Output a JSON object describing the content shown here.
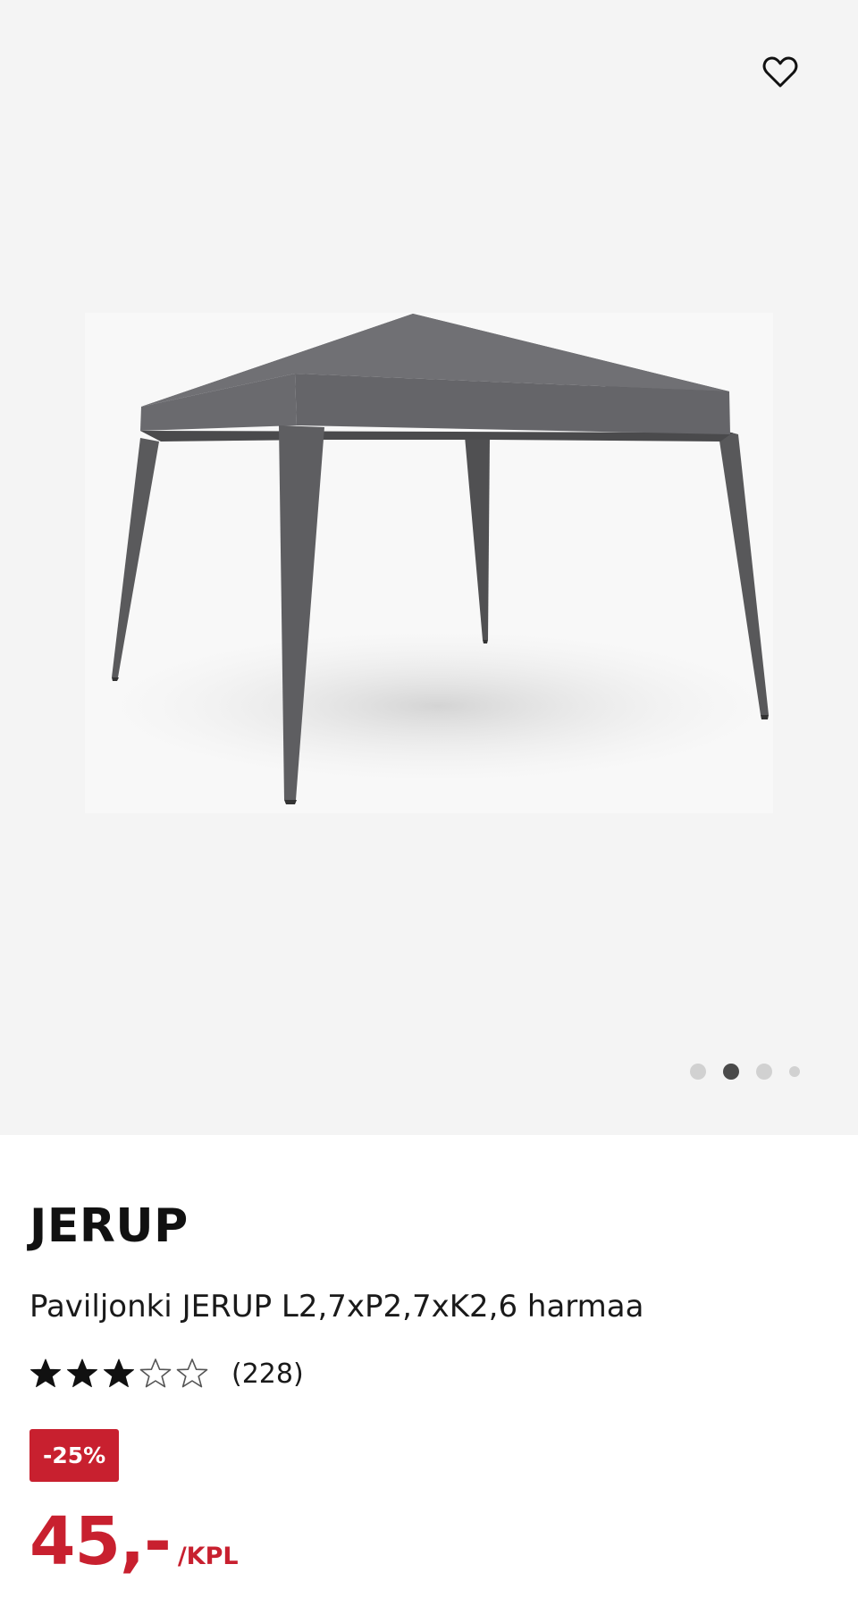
{
  "product": {
    "brand": "JERUP",
    "title": "Paviljonki JERUP L2,7xP2,7xK2,6 harmaa",
    "rating": {
      "value": 3,
      "max": 5,
      "review_count": "(228)"
    },
    "discount_label": "-25%",
    "price": "45,-",
    "unit": "/KPL"
  },
  "gallery": {
    "image_count": 4,
    "active_index": 1,
    "favorite_icon": "heart-outline-icon"
  },
  "colors": {
    "sale_red": "#c8202f",
    "gallery_bg": "#f4f4f4",
    "dot_active": "#4a4a4a",
    "dot_inactive": "#d1d1d1"
  }
}
